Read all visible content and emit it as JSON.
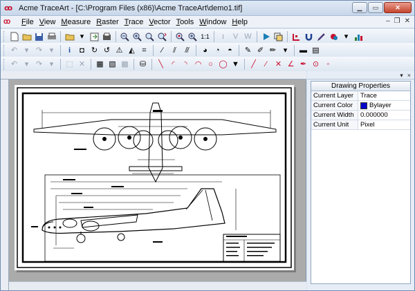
{
  "window": {
    "logo": "ꝏ",
    "title": "Acme TraceArt - [C:\\Program Files (x86)\\Acme TraceArt\\demo1.tif]",
    "controls": {
      "minimize": "▁",
      "maximize": "▭",
      "close": "✕"
    }
  },
  "menubar": {
    "items": [
      {
        "underline": "F",
        "rest": "ile"
      },
      {
        "underline": "V",
        "rest": "iew"
      },
      {
        "underline": "M",
        "rest": "easure"
      },
      {
        "underline": "R",
        "rest": "aster"
      },
      {
        "underline": "T",
        "rest": "race"
      },
      {
        "underline": "V",
        "rest": "ector"
      },
      {
        "underline": "T",
        "rest": "ools"
      },
      {
        "underline": "W",
        "rest": "indow"
      },
      {
        "underline": "H",
        "rest": "elp"
      }
    ],
    "mdi_controls": {
      "minimize": "–",
      "restore": "❐",
      "close": "✕"
    }
  },
  "toolbars": {
    "row1": [
      "new-icon",
      "open-icon",
      "save-icon",
      "print-icon",
      "folder-icon",
      "dropdown-icon",
      "export-icon",
      "fax-icon",
      "zoom-out-icon",
      "zoom-in-icon",
      "zoom-window-icon",
      "zoom-fit-icon",
      "zoom-all-icon",
      "zoom-prev-icon",
      "zoom-actual-icon",
      "vectorize-icon",
      "v-icon",
      "w-icon",
      "play-icon",
      "batch-icon",
      "node-icon",
      "magnet-icon",
      "pen-icon",
      "color-pick-icon",
      "chart-icon"
    ],
    "row1_labels": {
      "zoom_actual": "1:1",
      "vectorize": "V",
      "w": "W"
    },
    "accent_play": "#1a7fb5",
    "accent_red": "#c8102e"
  },
  "drawing_properties": {
    "title": "Drawing Properties",
    "rows": [
      {
        "label": "Current Layer",
        "value": "Trace"
      },
      {
        "label": "Current Color",
        "value": "Bylayer",
        "swatch": "#0000cc"
      },
      {
        "label": "Current Width",
        "value": "0.000000"
      },
      {
        "label": "Current Unit",
        "value": "Pixel"
      }
    ],
    "head_controls": {
      "pin": "▾",
      "close": "×"
    }
  }
}
